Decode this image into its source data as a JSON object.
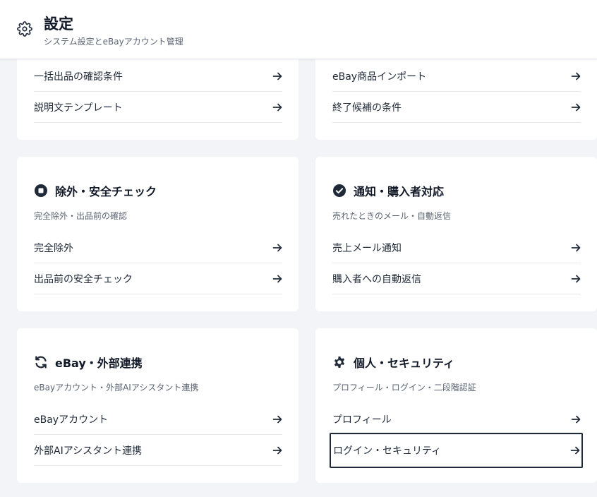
{
  "header": {
    "title": "設定",
    "subtitle": "システム設定とeBayアカウント管理"
  },
  "cards": {
    "top_left": {
      "items": [
        {
          "label": "一括出品の確認条件"
        },
        {
          "label": "説明文テンプレート"
        }
      ]
    },
    "top_right": {
      "items": [
        {
          "label": "eBay商品インポート"
        },
        {
          "label": "終了候補の条件"
        }
      ]
    },
    "exclusion": {
      "title": "除外・安全チェック",
      "desc": "完全除外・出品前の確認",
      "icon": "stop-circle-icon",
      "items": [
        {
          "label": "完全除外"
        },
        {
          "label": "出品前の安全チェック"
        }
      ]
    },
    "notify": {
      "title": "通知・購入者対応",
      "desc": "売れたときのメール・自動返信",
      "icon": "check-circle-icon",
      "items": [
        {
          "label": "売上メール通知"
        },
        {
          "label": "購入者への自動返信"
        }
      ]
    },
    "ebay": {
      "title": "eBay・外部連携",
      "desc": "eBayアカウント・外部AIアシスタント連携",
      "icon": "sync-icon",
      "items": [
        {
          "label": "eBayアカウント"
        },
        {
          "label": "外部AIアシスタント連携"
        }
      ]
    },
    "personal": {
      "title": "個人・セキュリティ",
      "desc": "プロフィール・ログイン・二段階認証",
      "icon": "gear-icon",
      "items": [
        {
          "label": "プロフィール"
        },
        {
          "label": "ログイン・セキュリティ"
        }
      ]
    }
  },
  "colors": {
    "background": "#f2f4f7",
    "card": "#ffffff",
    "text": "#1f2937",
    "muted": "#5b6472",
    "focus_border": "#1f2937"
  }
}
